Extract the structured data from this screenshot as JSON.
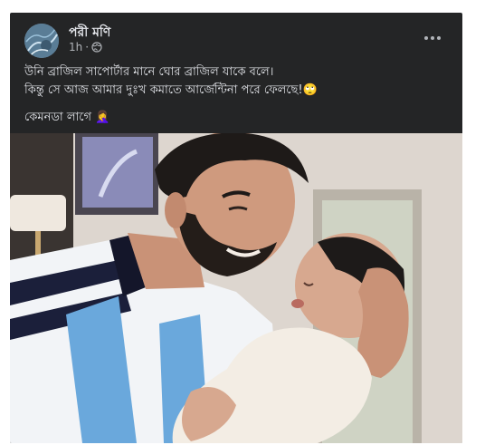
{
  "post": {
    "author_name": "পরী মণি",
    "timestamp": "1h",
    "audience_icon": "globe-icon",
    "more_icon": "more-options-icon",
    "caption_line_1": "উনি ব্রাজিল সাপোর্টার মানে ঘোর ব্রাজিল যাকে বলে।",
    "caption_line_2": "কিন্তু সে আজ আমার দুঃখ কমাতে আর্জেন্টিনা পরে ফেলছে!🙄",
    "caption_line_3": "কেমনডা লাগে 🤦‍♀️"
  },
  "colors": {
    "card_background": "#242526",
    "primary_text": "#e4e6eb",
    "secondary_text": "#b0b3b8"
  }
}
